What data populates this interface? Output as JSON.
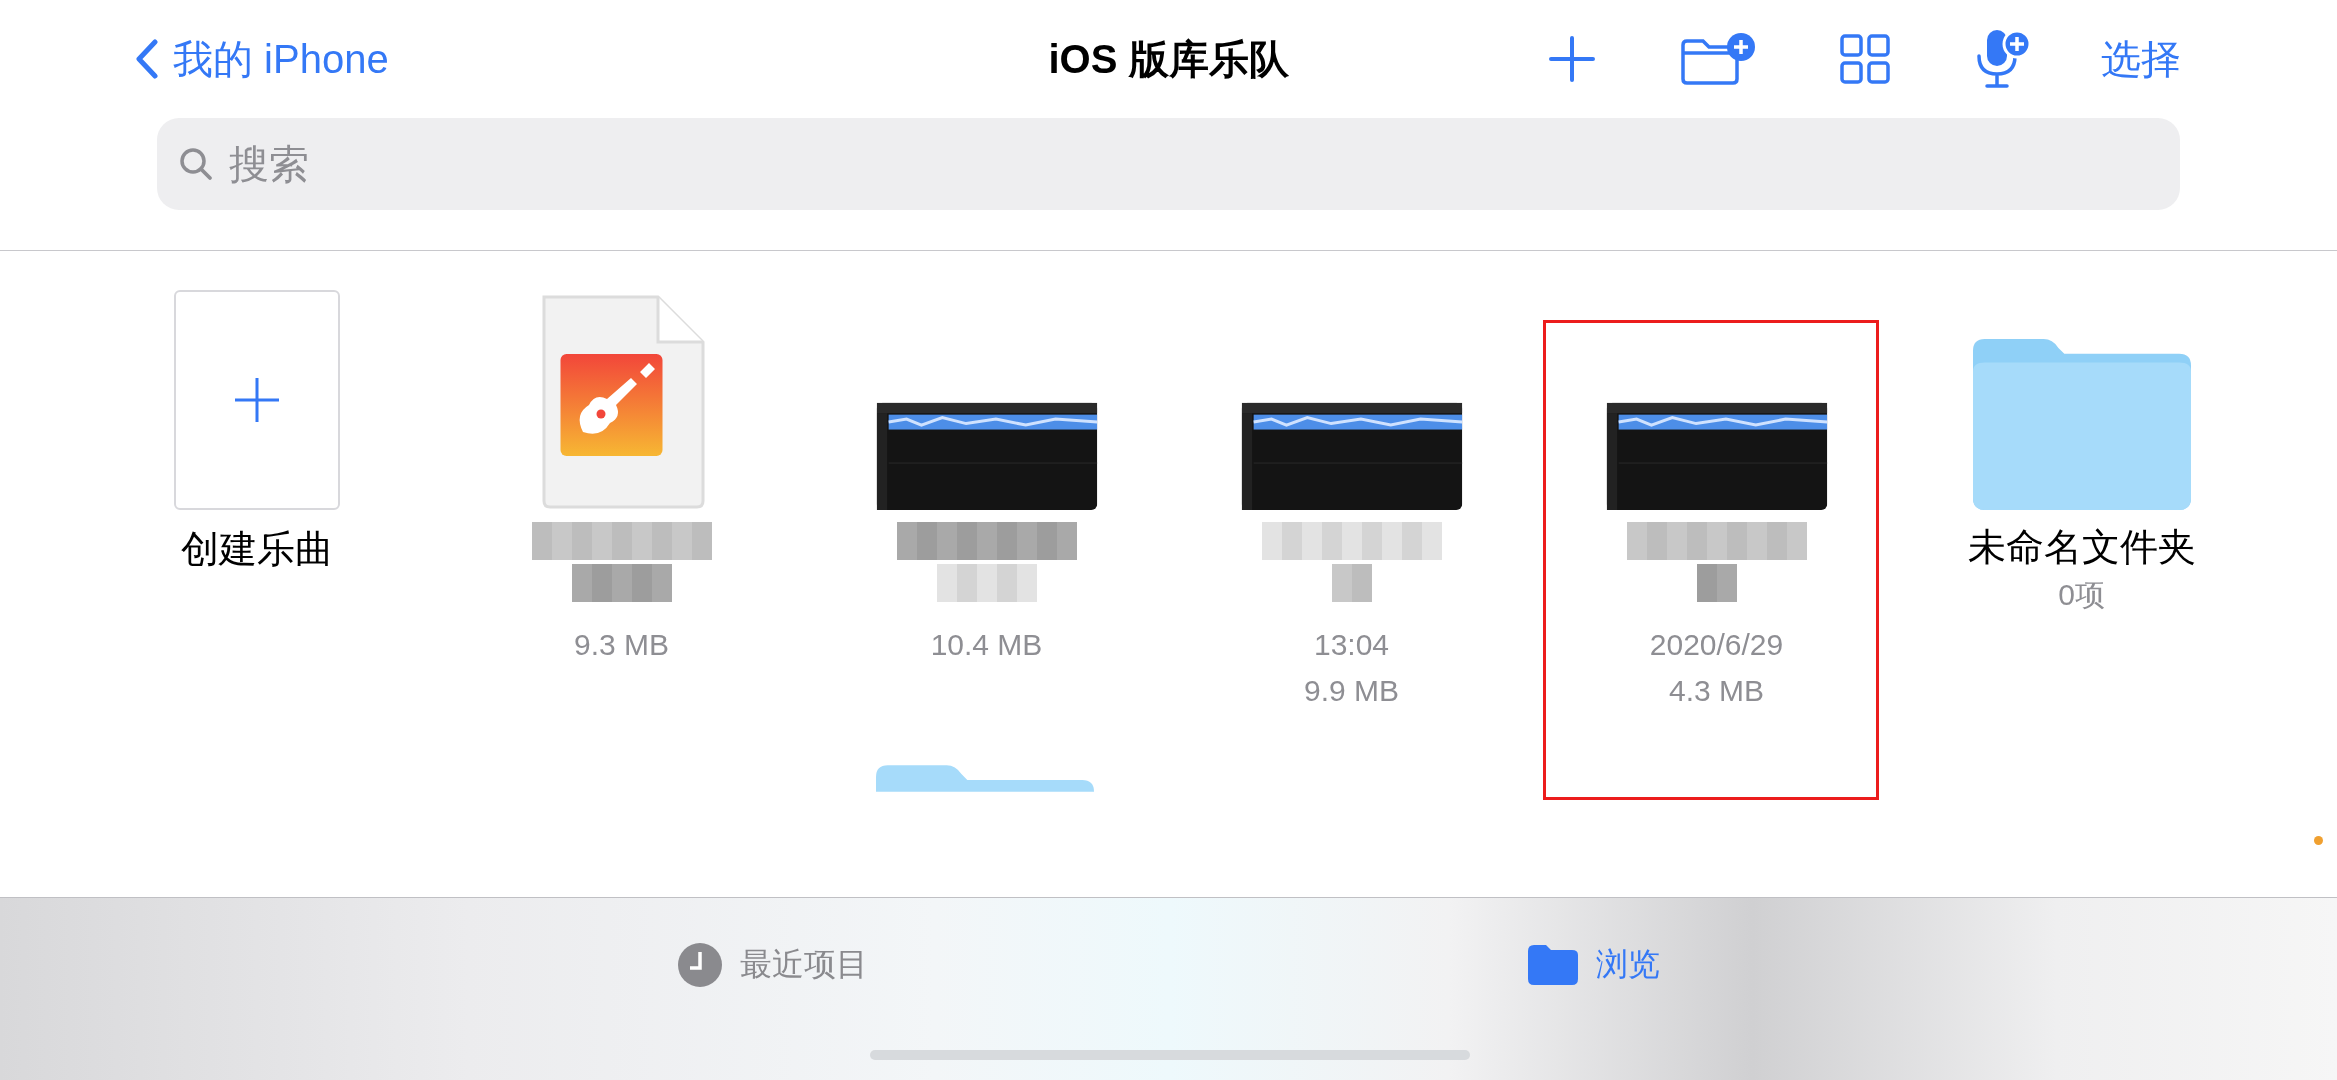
{
  "nav": {
    "back": "我的 iPhone",
    "title": "iOS 版库乐队",
    "select": "选择"
  },
  "search": {
    "placeholder": "搜索"
  },
  "items": [
    {
      "kind": "create",
      "label": "创建乐曲"
    },
    {
      "kind": "document",
      "redacted": true,
      "details": [
        "9.3 MB"
      ]
    },
    {
      "kind": "recording",
      "redacted": true,
      "details": [
        "10.4 MB"
      ]
    },
    {
      "kind": "recording",
      "redacted": true,
      "details": [
        "13:04",
        "9.9 MB"
      ]
    },
    {
      "kind": "recording",
      "redacted": true,
      "highlighted": true,
      "details": [
        "2020/6/29",
        "4.3 MB"
      ]
    },
    {
      "kind": "folder",
      "label": "未命名文件夹",
      "details": [
        "0项"
      ]
    }
  ],
  "peek": {
    "kind": "folder"
  },
  "tabs": [
    {
      "kind": "recent",
      "label": "最近项目",
      "selected": false
    },
    {
      "kind": "browse",
      "label": "浏览",
      "selected": true
    }
  ]
}
